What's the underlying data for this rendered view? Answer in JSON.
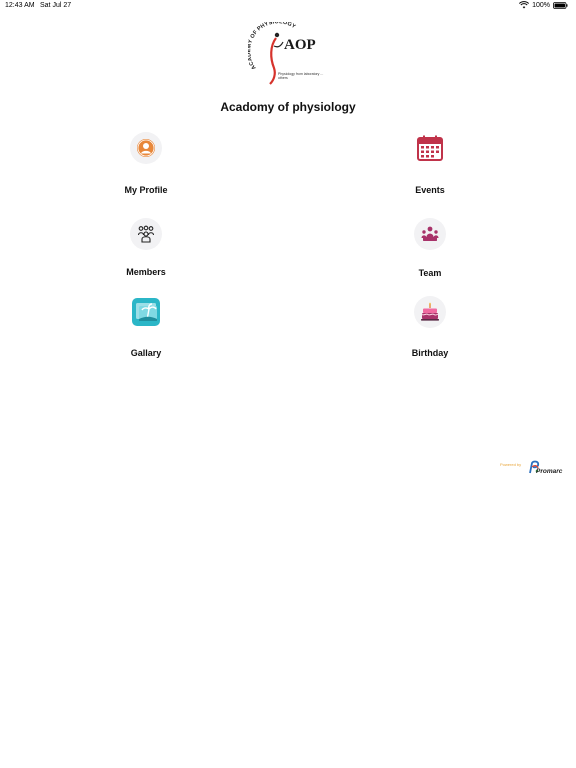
{
  "status_bar": {
    "time": "12:43 AM",
    "date": "Sat Jul 27",
    "battery": "100%"
  },
  "logo": {
    "ring_text": "ACADEMY OF PHYSIOLOGY",
    "initials": "AOP",
    "tagline": "Physiology from laboratory ... others"
  },
  "app": {
    "title": "Acadomy of physiology"
  },
  "menu": [
    {
      "label": "My Profile",
      "icon": "profile-icon"
    },
    {
      "label": "Events",
      "icon": "calendar-icon"
    },
    {
      "label": "Members",
      "icon": "members-icon"
    },
    {
      "label": "Team",
      "icon": "team-icon"
    },
    {
      "label": "Gallary",
      "icon": "gallery-icon"
    },
    {
      "label": "Birthday",
      "icon": "birthday-cake-icon"
    }
  ],
  "footer": {
    "powered_by": "Powered by",
    "brand": "Promarc"
  },
  "colors": {
    "icon_bg": "#f2f2f4",
    "accent_orange": "#e8873a",
    "accent_red": "#c0334a",
    "accent_teal": "#2bb6c7"
  }
}
